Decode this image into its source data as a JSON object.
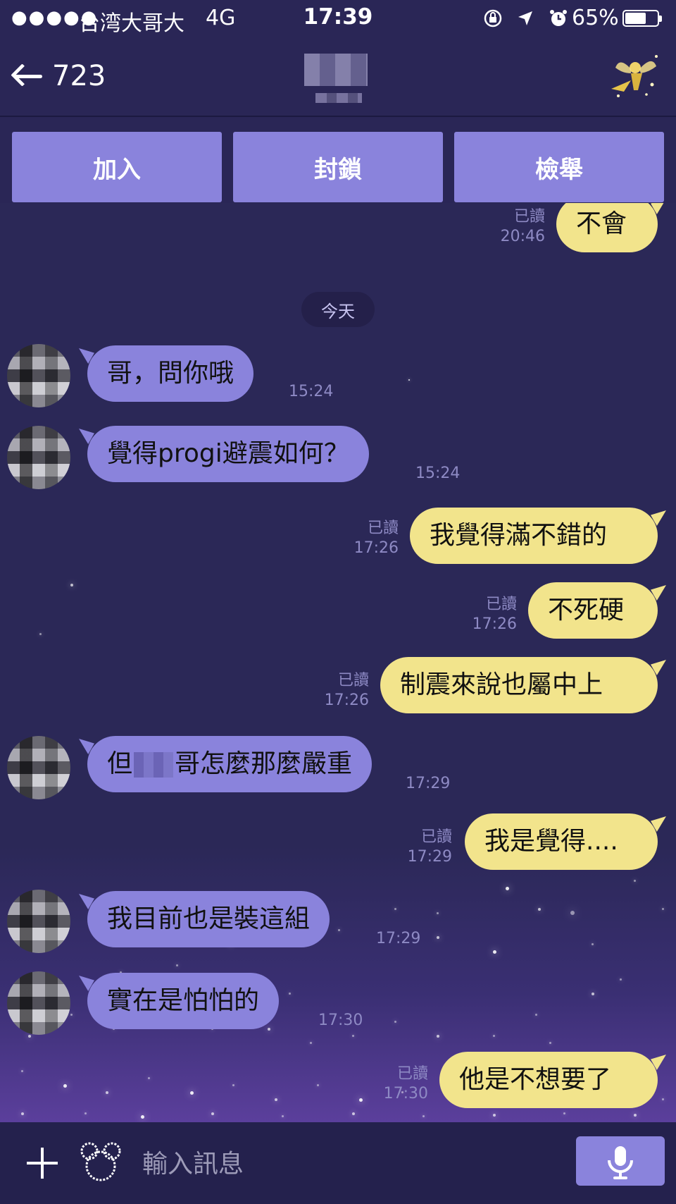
{
  "status_bar": {
    "signal": "●●●●●",
    "carrier": "台湾大哥大",
    "network": "4G",
    "time": "17:39",
    "icons": [
      "rotation-lock-icon",
      "location-icon",
      "alarm-icon"
    ],
    "battery_percent": "65%",
    "battery_level": 0.65
  },
  "header": {
    "back_count": "723",
    "actions": [
      {
        "label": "加入"
      },
      {
        "label": "封鎖"
      },
      {
        "label": "檢舉"
      }
    ]
  },
  "chat": {
    "date_separator": "今天",
    "messages": [
      {
        "direction": "outgoing",
        "text": "不會",
        "read": "已讀",
        "time": "20:46"
      },
      {
        "direction": "incoming",
        "text": "哥，問你哦",
        "time": "15:24"
      },
      {
        "direction": "incoming",
        "text": "覺得progi避震如何？",
        "time": "15:24"
      },
      {
        "direction": "outgoing",
        "text": "我覺得滿不錯的",
        "read": "已讀",
        "time": "17:26"
      },
      {
        "direction": "outgoing",
        "text": "不死硬",
        "read": "已讀",
        "time": "17:26"
      },
      {
        "direction": "outgoing",
        "text": "制震來說也屬中上",
        "read": "已讀",
        "time": "17:26"
      },
      {
        "direction": "incoming",
        "text_before": "但",
        "text_after": "哥怎麼那麼嚴重",
        "time": "17:29"
      },
      {
        "direction": "outgoing",
        "text": "我是覺得....",
        "read": "已讀",
        "time": "17:29"
      },
      {
        "direction": "incoming",
        "text": "我目前也是裝這組",
        "time": "17:29"
      },
      {
        "direction": "incoming",
        "text": "實在是怕怕的",
        "time": "17:30"
      },
      {
        "direction": "outgoing",
        "text": "他是不想要了",
        "read": "已讀",
        "time": "17:30"
      }
    ]
  },
  "input_bar": {
    "placeholder": "輸入訊息"
  },
  "colors": {
    "background": "#2a2656",
    "incoming_bubble": "#8a83dc",
    "outgoing_bubble": "#f2e48c",
    "meta_text": "#8e8ac4",
    "action_button": "#8a83dc"
  }
}
